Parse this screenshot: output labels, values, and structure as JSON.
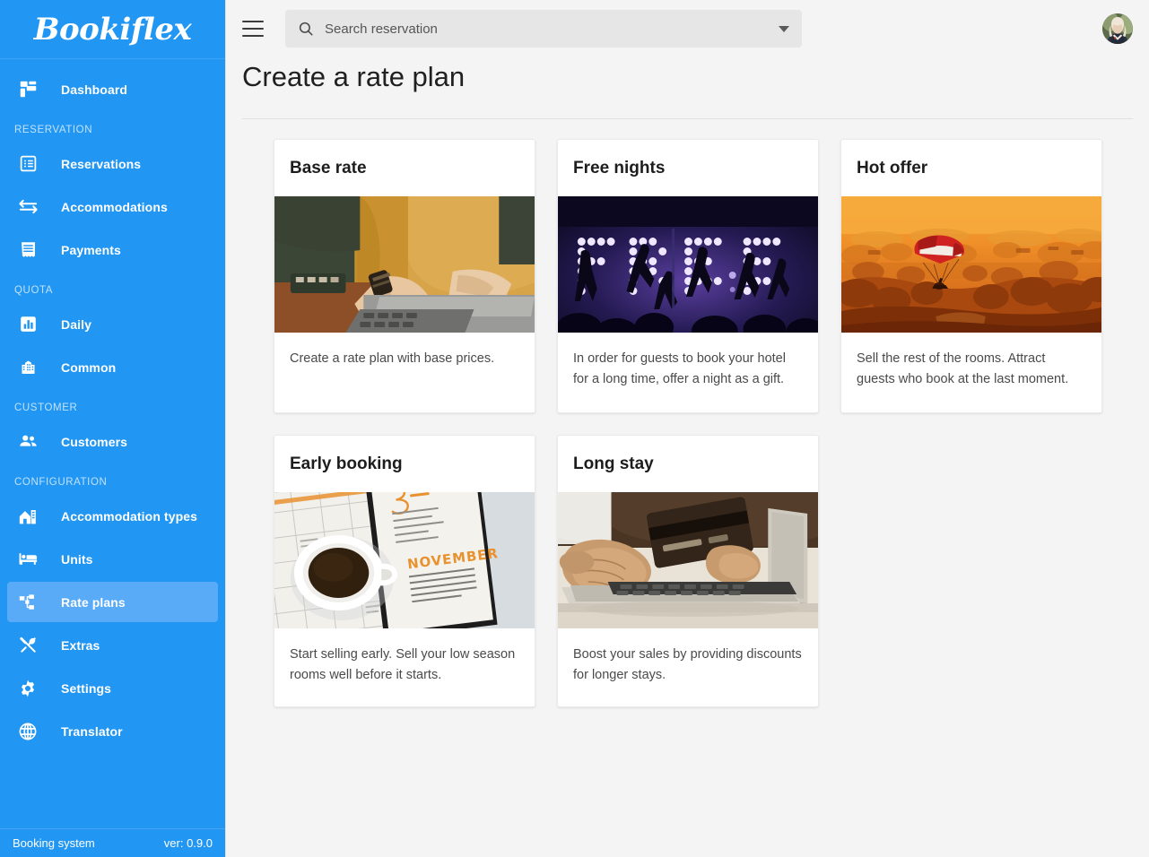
{
  "brand": {
    "logo_text": "Bookiflex"
  },
  "sidebar": {
    "items": [
      {
        "label": "Dashboard",
        "icon": "dashboard-grid-icon",
        "type": "item",
        "active": false
      },
      {
        "label": "RESERVATION",
        "type": "section"
      },
      {
        "label": "Reservations",
        "icon": "list-document-icon",
        "type": "item",
        "active": false
      },
      {
        "label": "Accommodations",
        "icon": "swap-arrows-icon",
        "type": "item",
        "active": false
      },
      {
        "label": "Payments",
        "icon": "receipt-icon",
        "type": "item",
        "active": false
      },
      {
        "label": "QUOTA",
        "type": "section"
      },
      {
        "label": "Daily",
        "icon": "bar-chart-icon",
        "type": "item",
        "active": false
      },
      {
        "label": "Common",
        "icon": "building-icon",
        "type": "item",
        "active": false
      },
      {
        "label": "CUSTOMER",
        "type": "section"
      },
      {
        "label": "Customers",
        "icon": "people-icon",
        "type": "item",
        "active": false
      },
      {
        "label": "CONFIGURATION",
        "type": "section"
      },
      {
        "label": "Accommodation types",
        "icon": "home-building-icon",
        "type": "item",
        "active": false
      },
      {
        "label": "Units",
        "icon": "bed-icon",
        "type": "item",
        "active": false
      },
      {
        "label": "Rate plans",
        "icon": "sitemap-icon",
        "type": "item",
        "active": true
      },
      {
        "label": "Extras",
        "icon": "fork-spoon-icon",
        "type": "item",
        "active": false
      },
      {
        "label": "Settings",
        "icon": "gear-icon",
        "type": "item",
        "active": false
      },
      {
        "label": "Translator",
        "icon": "globe-icon",
        "type": "item",
        "active": false
      }
    ],
    "footer": {
      "name": "Booking system",
      "version": "ver: 0.9.0"
    }
  },
  "topbar": {
    "menu_icon": "hamburger-icon",
    "search": {
      "placeholder": "Search reservation",
      "value": "",
      "icon": "search-icon",
      "caret": "chevron-down-icon"
    },
    "avatar": "user-avatar"
  },
  "page": {
    "title": "Create a rate plan"
  },
  "cards": [
    {
      "title": "Base rate",
      "description": "Create a rate plan with base prices.",
      "image": "person-in-mustard-sweater-typing-on-laptop"
    },
    {
      "title": "Free nights",
      "description": "In order for guests to book your hotel for a long time, offer a night as a gift.",
      "image": "illuminated-free-letters-on-stage-with-dancers"
    },
    {
      "title": "Hot offer",
      "description": "Sell the rest of the rooms. Attract guests who book at the last moment.",
      "image": "red-paraglider-over-orange-sunset-landscape"
    },
    {
      "title": "Early booking",
      "description": "Start selling early. Sell your low season rooms well before it starts.",
      "image": "coffee-cup-on-november-calendar-planner"
    },
    {
      "title": "Long stay",
      "description": "Boost your sales by providing discounts for longer stays.",
      "image": "hands-with-credit-card-at-laptop"
    }
  ],
  "colors": {
    "sidebar": "#2196f3",
    "sidebar_active": "#5aabf7",
    "page_bg": "#f4f4f4",
    "card_bg": "#ffffff",
    "title_text": "#202020"
  }
}
